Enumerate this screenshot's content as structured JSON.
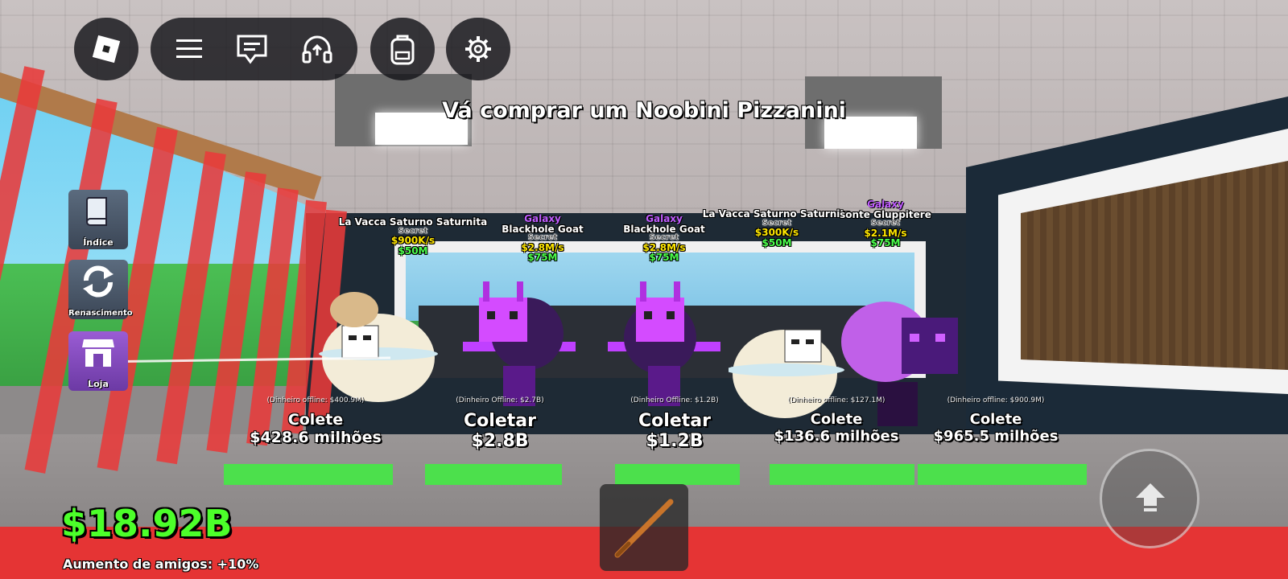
{
  "objective": "Vá comprar um Noobini Pizzanini",
  "top_bar": {
    "roblox_icon": "roblox-logo-icon",
    "menu_icon": "hamburger-menu-icon",
    "chat_icon": "chat-icon",
    "voice_icon": "headphones-icon",
    "backpack_icon": "backpack-icon",
    "settings_icon": "gear-icon"
  },
  "side_menu": [
    {
      "label": "Índice",
      "icon": "book-icon"
    },
    {
      "label": "Renascimento",
      "icon": "refresh-icon"
    },
    {
      "label": "Loja",
      "icon": "shop-icon"
    }
  ],
  "brainrots": [
    {
      "name": "La Vacca Saturno Saturnita",
      "rarity": "Secret",
      "rate": "$900K/s",
      "price": "$50M",
      "offline": "(Dinheiro offline: $400.9M)",
      "collect_label": "Colete",
      "collect_amount": "$428.6 milhões"
    },
    {
      "rarity_top": "Galaxy",
      "name": "Blackhole Goat",
      "rarity": "Secret",
      "rate": "$2.8M/s",
      "price": "$75M",
      "offline": "(Dinheiro Offline: $2.7B)",
      "collect_label": "Coletar",
      "collect_amount": "$2.8B"
    },
    {
      "rarity_top": "Galaxy",
      "name": "Blackhole Goat",
      "rarity": "Secret",
      "rate": "$2.8M/s",
      "price": "$75M",
      "offline": "(Dinheiro Offline: $1.2B)",
      "collect_label": "Coletar",
      "collect_amount": "$1.2B"
    },
    {
      "name": "La Vacca Saturno Saturnita",
      "rarity": "Secret",
      "rate": "$300K/s",
      "price": "$50M",
      "offline": "(Dinheiro offline: $127.1M)",
      "collect_label": "Colete",
      "collect_amount": "$136.6 milhões"
    },
    {
      "rarity_top": "Galaxy",
      "name": "sonte Gluppitere",
      "rarity": "Secret",
      "rate": "$2.1M/s",
      "price": "$75M",
      "offline": "(Dinheiro offline: $900.9M)",
      "collect_label": "Colete",
      "collect_amount": "$965.5 milhões"
    }
  ],
  "hud": {
    "money": "$18.92B",
    "friends_boost": "Aumento de amigos: +10%"
  },
  "hotbar": {
    "slot1_item": "baseball-bat-icon"
  },
  "jump_button_icon": "jump-arrow-icon",
  "colors": {
    "money_green": "#4cff2a",
    "galaxy_purple": "#c05cff",
    "rate_yellow": "#ffe600",
    "pad_green": "#4ce04c",
    "floor_red": "#e53434"
  }
}
